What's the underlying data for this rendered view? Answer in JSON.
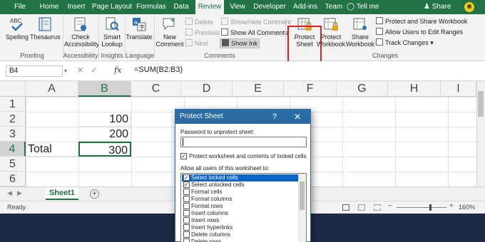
{
  "tabs": {
    "file": "File",
    "home": "Home",
    "insert": "Insert",
    "page_layout": "Page Layout",
    "formulas": "Formulas",
    "data": "Data",
    "review": "Review",
    "view": "View",
    "developer": "Developer",
    "addins": "Add-ins",
    "team": "Team",
    "tell_me": "Tell me",
    "share": "Share"
  },
  "ribbon": {
    "spelling": "Spelling",
    "thesaurus": "Thesaurus",
    "proofing": "Proofing",
    "check_accessibility": [
      "Check",
      "Accessibility"
    ],
    "accessibility": "Accessibility",
    "smart_lookup": [
      "Smart",
      "Lookup"
    ],
    "insights": "Insights",
    "translate": "Translate",
    "language": "Language",
    "new_comment": [
      "New",
      "Comment"
    ],
    "delete": "Delete",
    "previous": "Previous",
    "next": "Next",
    "show_hide_comment": "Show/Hide Comment",
    "show_all_comments": "Show All Comments",
    "show_ink": "Show Ink",
    "comments": "Comments",
    "protect_sheet": [
      "Protect",
      "Sheet"
    ],
    "protect_workbook": [
      "Protect",
      "Workbook"
    ],
    "share_workbook": [
      "Share",
      "Workbook"
    ],
    "protect_and_share_workbook": "Protect and Share Workbook",
    "allow_users_to_edit_ranges": "Allow Users to Edit Ranges",
    "track_changes": "Track Changes",
    "changes": "Changes"
  },
  "formula_bar": {
    "name_box": "B4",
    "fx": "fx",
    "formula": "=SUM(B2:B3)"
  },
  "grid": {
    "columns": [
      "A",
      "B",
      "C",
      "D",
      "E",
      "F",
      "G",
      "H",
      "I"
    ],
    "rows": [
      "1",
      "2",
      "3",
      "4",
      "5",
      "6"
    ],
    "cells": {
      "B2": "100",
      "B3": "200",
      "A4": "Total",
      "B4": "300"
    }
  },
  "sheet_tabs": {
    "active": "Sheet1",
    "add": "+"
  },
  "status": {
    "ready": "Ready",
    "zoom": "160%"
  },
  "dialog": {
    "title": "Protect Sheet",
    "help": "?",
    "close": "✕",
    "password_label": "Password to unprotect sheet:",
    "password_value": "",
    "protect_checkbox_label": "Protect worksheet and contents of locked cells",
    "protect_checked": true,
    "allow_label": "Allow all users of this worksheet to:",
    "permissions": [
      {
        "label": "Select locked cells",
        "checked": true,
        "selected": true
      },
      {
        "label": "Select unlocked cells",
        "checked": true,
        "selected": false
      },
      {
        "label": "Format cells",
        "checked": false,
        "selected": false
      },
      {
        "label": "Format columns",
        "checked": false,
        "selected": false
      },
      {
        "label": "Format rows",
        "checked": false,
        "selected": false
      },
      {
        "label": "Insert columns",
        "checked": false,
        "selected": false
      },
      {
        "label": "Insert rows",
        "checked": false,
        "selected": false
      },
      {
        "label": "Insert hyperlinks",
        "checked": false,
        "selected": false
      },
      {
        "label": "Delete columns",
        "checked": false,
        "selected": false
      },
      {
        "label": "Delete rows",
        "checked": false,
        "selected": false
      }
    ]
  },
  "colors": {
    "excel_green": "#217346",
    "dialog_blue": "#2b6ca3",
    "selection_blue": "#0a64c8",
    "highlight_red": "#e02020"
  }
}
